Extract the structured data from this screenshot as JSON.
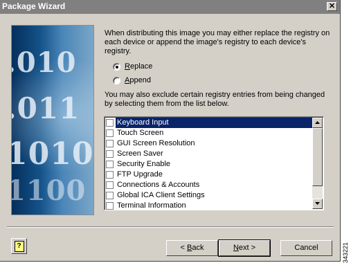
{
  "window": {
    "title": "Package Wizard",
    "close_glyph": "✕",
    "close_icon": "close-icon"
  },
  "hero": {
    "digits": [
      ".010",
      ".011",
      "1010",
      "1100"
    ]
  },
  "intro_text": "When distributing this image you may either replace the registry on each device or append the image's registry to each device's registry.",
  "registry_mode": {
    "options": [
      {
        "prefix": "",
        "mnemonic": "R",
        "suffix": "eplace",
        "selected": true
      },
      {
        "prefix": "",
        "mnemonic": "A",
        "suffix": "ppend",
        "selected": false
      }
    ]
  },
  "exclude_text": "You may also exclude certain registry entries from being changed by selecting them from the list below.",
  "registry_list": {
    "items": [
      {
        "label": "Keyboard Input",
        "checked": false,
        "selected": true
      },
      {
        "label": "Touch Screen",
        "checked": false,
        "selected": false
      },
      {
        "label": "GUI Screen Resolution",
        "checked": false,
        "selected": false
      },
      {
        "label": "Screen Saver",
        "checked": false,
        "selected": false
      },
      {
        "label": "Security Enable",
        "checked": false,
        "selected": false
      },
      {
        "label": "FTP Upgrade",
        "checked": false,
        "selected": false
      },
      {
        "label": "Connections & Accounts",
        "checked": false,
        "selected": false
      },
      {
        "label": "Global ICA Client Settings",
        "checked": false,
        "selected": false
      },
      {
        "label": "Terminal Information",
        "checked": false,
        "selected": false
      }
    ],
    "scroll_up_icon": "scroll-up-arrow-icon",
    "scroll_down_icon": "scroll-down-arrow-icon"
  },
  "buttons": {
    "help_glyph": "?",
    "back": {
      "prefix": "< ",
      "mnemonic": "B",
      "suffix": "ack"
    },
    "next": {
      "prefix": "",
      "mnemonic": "N",
      "suffix": "ext >"
    },
    "cancel": "Cancel"
  },
  "figure_id": "343221"
}
